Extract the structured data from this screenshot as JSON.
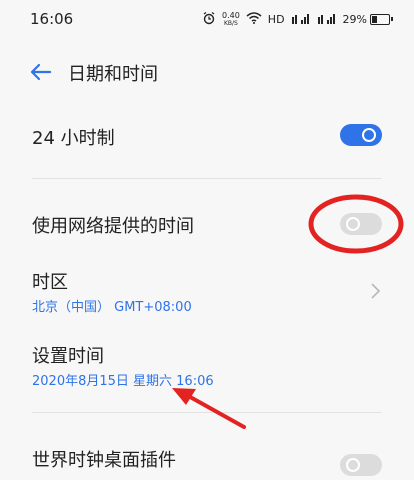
{
  "status_bar": {
    "time": "16:06",
    "net_speed_value": "0.40",
    "net_speed_unit": "KB/S",
    "signal_text": "HD",
    "battery_percent": "29%"
  },
  "header": {
    "title": "日期和时间",
    "back_icon": "arrow-left-icon"
  },
  "settings": {
    "format_24h": {
      "label": "24 小时制",
      "enabled": true
    },
    "network_time": {
      "label": "使用网络提供的时间",
      "enabled": false
    },
    "timezone": {
      "label": "时区",
      "value": "北京（中国） GMT+08:00"
    },
    "set_time": {
      "label": "设置时间",
      "value": "2020年8月15日 星期六 16:06"
    },
    "world_clock": {
      "label": "世界时钟桌面插件",
      "enabled": false
    }
  },
  "colors": {
    "accent": "#2f73e8",
    "annotation": "#e32222"
  }
}
